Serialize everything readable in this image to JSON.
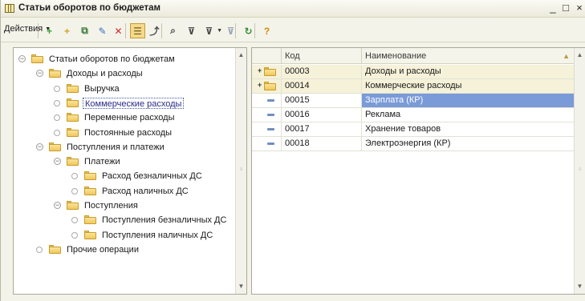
{
  "window": {
    "title": "Статьи оборотов по бюджетам",
    "icon": "table-icon",
    "buttons": {
      "minimize": "_",
      "maximize": "□",
      "close": "×"
    }
  },
  "toolbar": {
    "actions_label": "Действия",
    "buttons": [
      {
        "name": "add-icon",
        "glyph": "+",
        "color": "#3aa83a"
      },
      {
        "name": "add-group-icon",
        "glyph": "+",
        "color": "#d4a421"
      },
      {
        "name": "copy-icon",
        "glyph": "⧉",
        "color": "#3b7d3b"
      },
      {
        "name": "edit-icon",
        "glyph": "✎",
        "color": "#3a6fb8"
      },
      {
        "name": "delete-icon",
        "glyph": "✕",
        "color": "#d22b2b"
      },
      {
        "name": "hierarchy-mode-icon",
        "glyph": "☰",
        "color": "#6b5a1e",
        "active": true
      },
      {
        "name": "parent-level-icon",
        "glyph": "⤴",
        "color": "#4a4a4a"
      },
      {
        "name": "find-icon",
        "glyph": "⌕",
        "color": "#4a4a4a"
      },
      {
        "name": "filter-icon",
        "glyph": "⊽",
        "color": "#4a4a4a"
      },
      {
        "name": "filter-list-icon",
        "glyph": "⊽",
        "color": "#4a4a4a",
        "dropdown": true
      },
      {
        "name": "clear-filter-icon",
        "glyph": "⊽",
        "color": "#9aa6b8"
      },
      {
        "name": "refresh-icon",
        "glyph": "↻",
        "color": "#2f8f2f"
      },
      {
        "name": "help-icon",
        "glyph": "?",
        "color": "#d48a10"
      }
    ]
  },
  "tree": {
    "items": [
      {
        "label": "Статьи оборотов по бюджетам",
        "level": 0,
        "state": "expanded"
      },
      {
        "label": "Доходы и расходы",
        "level": 1,
        "state": "expanded"
      },
      {
        "label": "Выручка",
        "level": 2,
        "state": "leaf"
      },
      {
        "label": "Коммерческие расходы",
        "level": 2,
        "state": "leaf",
        "selected": true
      },
      {
        "label": "Переменные расходы",
        "level": 2,
        "state": "leaf"
      },
      {
        "label": "Постоянные расходы",
        "level": 2,
        "state": "leaf"
      },
      {
        "label": "Поступления и платежи",
        "level": 1,
        "state": "expanded"
      },
      {
        "label": "Платежи",
        "level": 2,
        "state": "expanded"
      },
      {
        "label": "Расход безналичных ДС",
        "level": 3,
        "state": "leaf"
      },
      {
        "label": "Расход наличных ДС",
        "level": 3,
        "state": "leaf"
      },
      {
        "label": "Поступления",
        "level": 2,
        "state": "expanded"
      },
      {
        "label": "Поступления безналичных ДС",
        "level": 3,
        "state": "leaf"
      },
      {
        "label": "Поступления наличных ДС",
        "level": 3,
        "state": "leaf"
      },
      {
        "label": "Прочие операции",
        "level": 1,
        "state": "leaf"
      }
    ]
  },
  "grid": {
    "columns": {
      "code": "Код",
      "name": "Наименование"
    },
    "rows": [
      {
        "type": "group",
        "code": "00003",
        "name": "Доходы и расходы"
      },
      {
        "type": "group",
        "code": "00014",
        "name": "Коммерческие расходы"
      },
      {
        "type": "item",
        "code": "00015",
        "name": "Зарплата (КР)",
        "selected": true
      },
      {
        "type": "item",
        "code": "00016",
        "name": "Реклама"
      },
      {
        "type": "item",
        "code": "00017",
        "name": "Хранение товаров"
      },
      {
        "type": "item",
        "code": "00018",
        "name": "Электроэнергия (КР)"
      }
    ]
  }
}
